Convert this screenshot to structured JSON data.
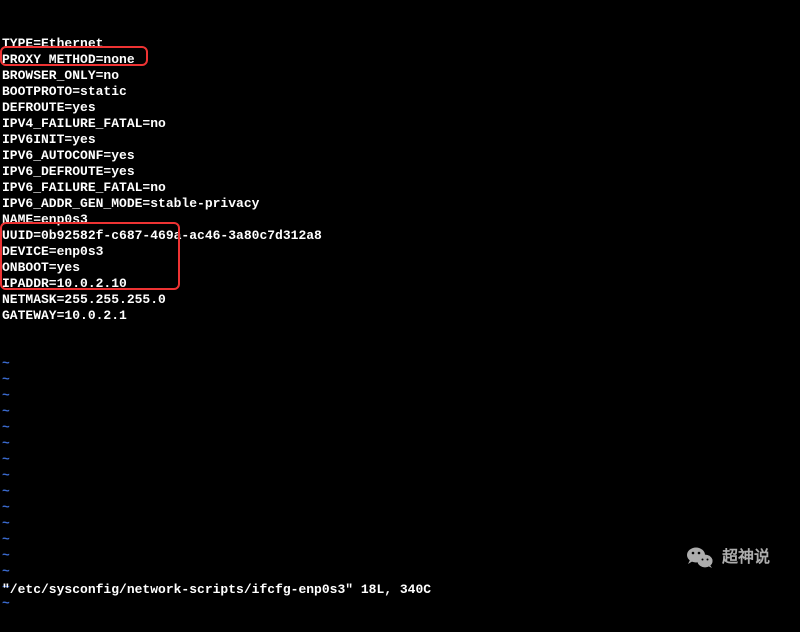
{
  "config_lines": [
    "TYPE=Ethernet",
    "PROXY_METHOD=none",
    "BROWSER_ONLY=no",
    "BOOTPROTO=static",
    "DEFROUTE=yes",
    "IPV4_FAILURE_FATAL=no",
    "IPV6INIT=yes",
    "IPV6_AUTOCONF=yes",
    "IPV6_DEFROUTE=yes",
    "IPV6_FAILURE_FATAL=no",
    "IPV6_ADDR_GEN_MODE=stable-privacy",
    "NAME=enp0s3",
    "UUID=0b92582f-c687-469a-ac46-3a80c7d312a8",
    "DEVICE=enp0s3",
    "ONBOOT=yes",
    "IPADDR=10.0.2.10",
    "NETMASK=255.255.255.0",
    "GATEWAY=10.0.2.1"
  ],
  "tilde_count": 16,
  "status_line": "\"/etc/sysconfig/network-scripts/ifcfg-enp0s3\" 18L, 340C",
  "watermark_text": "超神说"
}
